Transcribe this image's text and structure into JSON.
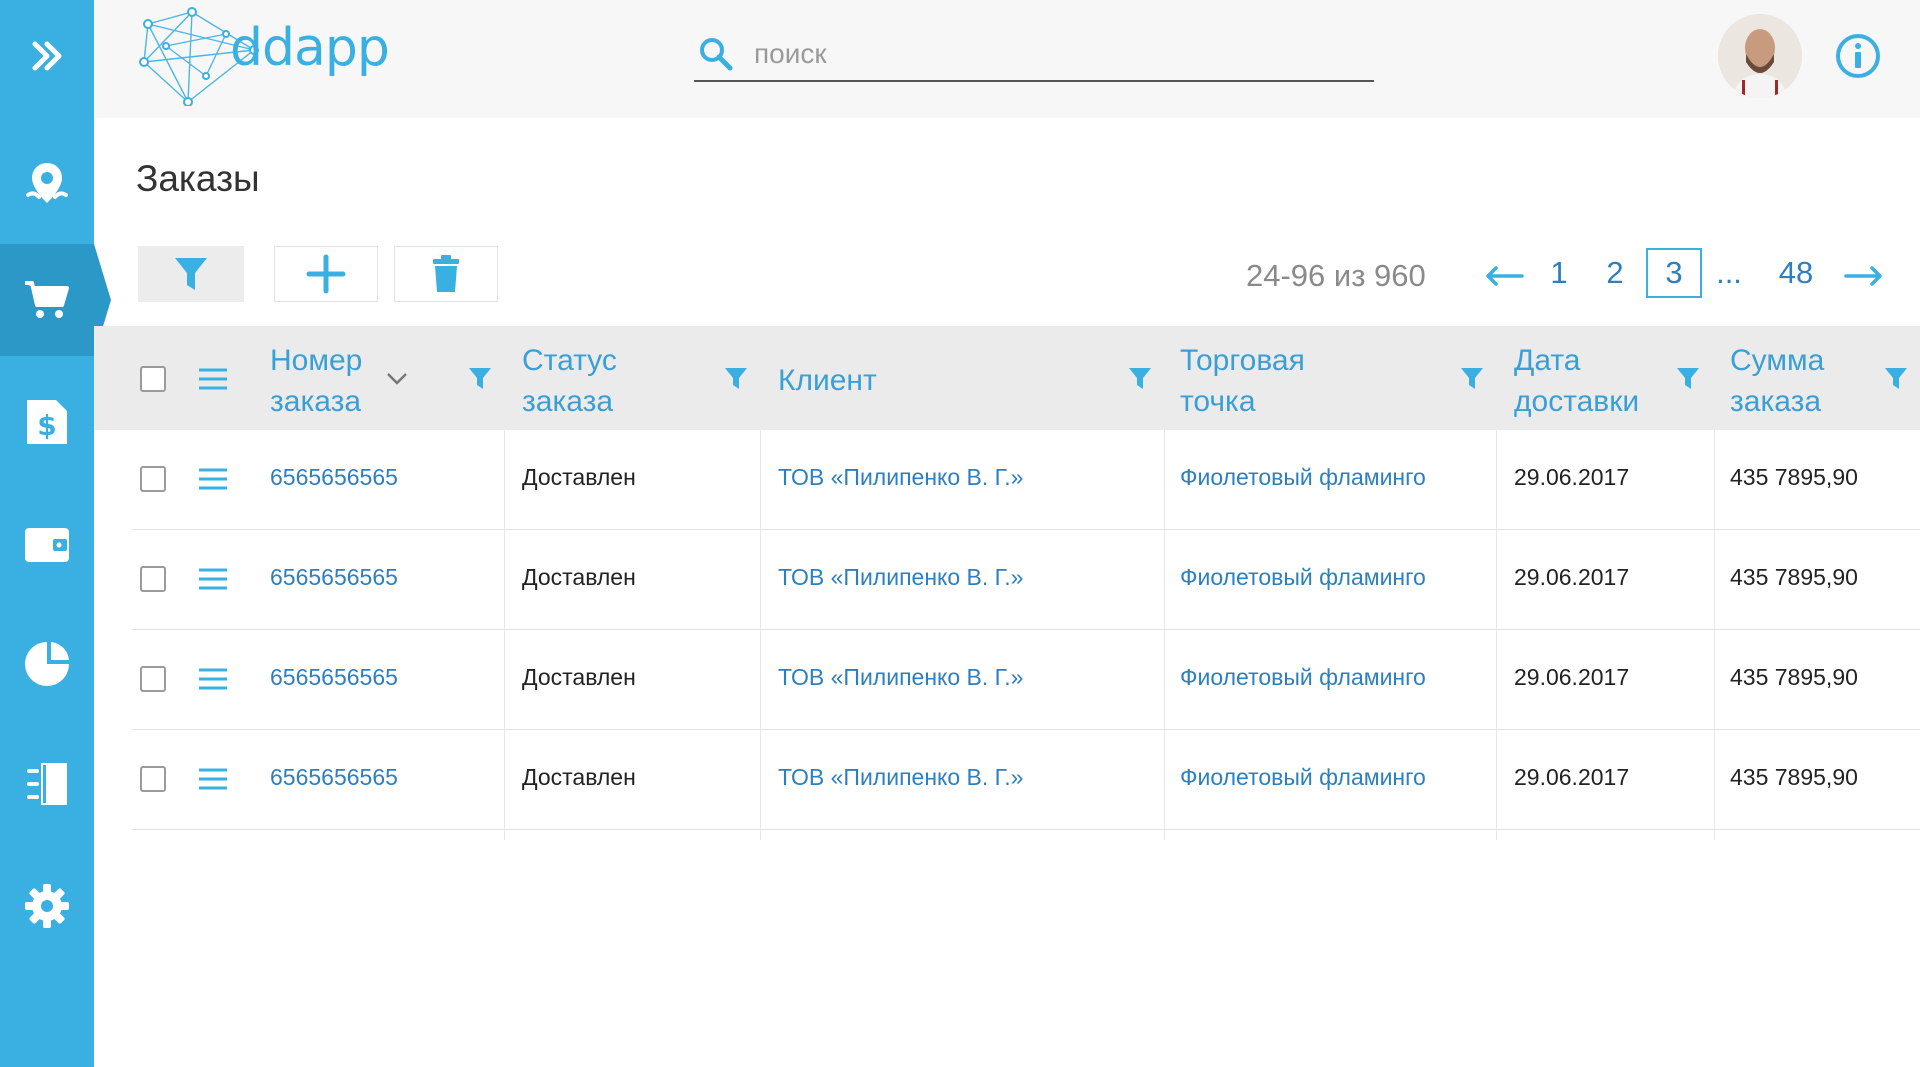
{
  "app": {
    "logo_text": "ddapp"
  },
  "sidebar": {
    "items": [
      {
        "icon": "expand-icon"
      },
      {
        "icon": "map-pin-icon"
      },
      {
        "icon": "cart-icon",
        "active": true
      },
      {
        "icon": "invoice-dollar-icon"
      },
      {
        "icon": "wallet-icon"
      },
      {
        "icon": "pie-chart-icon"
      },
      {
        "icon": "door-exit-icon"
      },
      {
        "icon": "gear-icon"
      }
    ]
  },
  "search": {
    "placeholder": "поиск",
    "value": ""
  },
  "page": {
    "title": "Заказы"
  },
  "pagination": {
    "range": "24-96 из 960",
    "pages": [
      "1",
      "2",
      "3",
      "...",
      "48"
    ],
    "current": "3"
  },
  "table": {
    "headers": {
      "order_number": "Номер заказа",
      "status": "Статус заказа",
      "client": "Клиент",
      "outlet": "Торговая точка",
      "delivery_date": "Дата доставки",
      "sum": "Сумма заказа"
    },
    "rows": [
      {
        "order_number": "6565656565",
        "status": "Доставлен",
        "client": "ТОВ «Пилипенко В. Г.»",
        "outlet": "Фиолетовый фламинго",
        "delivery_date": "29.06.2017",
        "sum": "435 7895,90"
      },
      {
        "order_number": "6565656565",
        "status": "Доставлен",
        "client": "ТОВ «Пилипенко В. Г.»",
        "outlet": "Фиолетовый фламинго",
        "delivery_date": "29.06.2017",
        "sum": "435 7895,90"
      },
      {
        "order_number": "6565656565",
        "status": "Доставлен",
        "client": "ТОВ «Пилипенко В. Г.»",
        "outlet": "Фиолетовый фламинго",
        "delivery_date": "29.06.2017",
        "sum": "435 7895,90"
      },
      {
        "order_number": "6565656565",
        "status": "Доставлен",
        "client": "ТОВ «Пилипенко В. Г.»",
        "outlet": "Фиолетовый фламинго",
        "delivery_date": "29.06.2017",
        "sum": "435 7895,90"
      }
    ]
  },
  "colors": {
    "accent": "#3ab0e2",
    "link": "#2d7fbf",
    "sidebar": "#3ab0e2",
    "header_bg": "#ebebeb"
  }
}
